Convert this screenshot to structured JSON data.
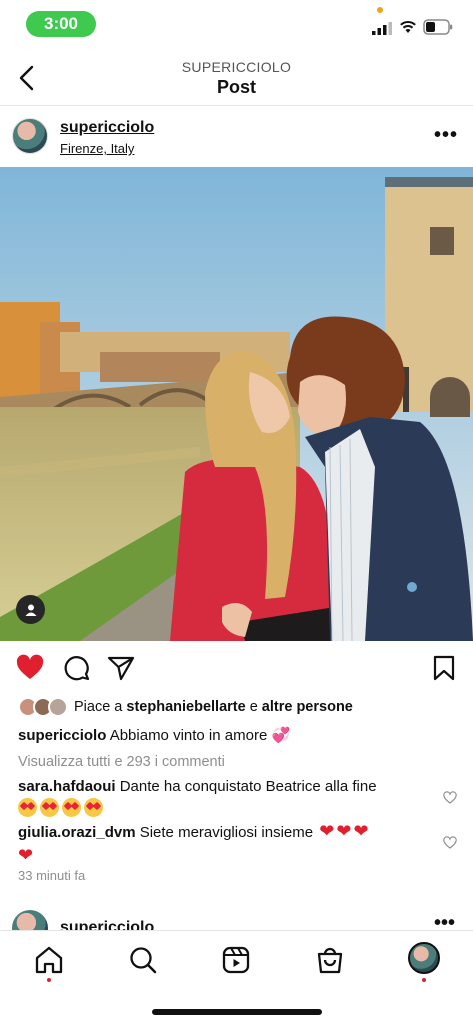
{
  "status": {
    "time": "3:00"
  },
  "header": {
    "username": "SUPERICCIOLO",
    "title": "Post"
  },
  "post": {
    "username": "supericciolo",
    "location": "Firenze, Italy",
    "liked": true,
    "likes": {
      "prefix": "Piace a ",
      "user": "stephaniebellarte",
      "middle": " e ",
      "others": "altre persone"
    },
    "caption": {
      "user": "supericciolo",
      "text": " Abbiamo vinto in amore 💞"
    },
    "view_all": "Visualizza tutti e 293 i commenti",
    "comments": [
      {
        "user": "sara.hafdaoui",
        "text": " Dante ha conquistato Beatrice alla fine"
      },
      {
        "user": "giulia.orazi_dvm",
        "text": " Siete meravigliosi insieme"
      }
    ],
    "time_ago": "33 minuti fa"
  },
  "next_post": {
    "username": "supericciolo"
  },
  "colors": {
    "accent_red": "#e0202f",
    "time_pill": "#3ec94f"
  },
  "icons": [
    "back-icon",
    "more-icon",
    "heart-icon",
    "comment-icon",
    "share-icon",
    "bookmark-icon",
    "home-icon",
    "search-icon",
    "reels-icon",
    "shop-icon",
    "tag-person-icon"
  ]
}
